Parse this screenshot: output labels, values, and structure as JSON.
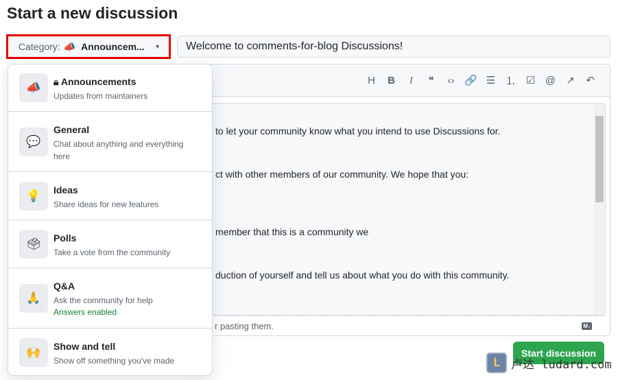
{
  "page_title": "Start a new discussion",
  "category_selector": {
    "label": "Category:",
    "icon": "megaphone-icon",
    "value": "Announcem...",
    "highlight_color": "#e00000"
  },
  "title_input": {
    "value": "Welcome to comments-for-blog Discussions!"
  },
  "toolbar": [
    "heading",
    "bold",
    "italic",
    "quote",
    "code",
    "link",
    "unordered-list",
    "ordered-list",
    "task-list",
    "mention",
    "reference",
    "undo"
  ],
  "toolbar_glyphs": [
    "H",
    "B",
    "I",
    "❝",
    "‹›",
    "🔗",
    "☰",
    "⒈",
    "☑",
    "@",
    "↗",
    "↶"
  ],
  "body_lines": [
    "to let your community know what you intend to use Discussions for.",
    "ct with other members of our community. We hope that you:",
    "member that this is a community we",
    "duction of yourself and tell us about what you do with this community."
  ],
  "footer_text": "r pasting them.",
  "markdown_badge": "M↓",
  "submit_label": "Start discussion",
  "submit_color": "#2da44e",
  "categories": [
    {
      "name": "Announcements",
      "description": "Updates from maintainers",
      "icon": "megaphone-icon",
      "emoji": "📣",
      "locked": true
    },
    {
      "name": "General",
      "description": "Chat about anything and everything here",
      "icon": "speech-balloon-icon",
      "emoji": "💬"
    },
    {
      "name": "Ideas",
      "description": "Share ideas for new features",
      "icon": "light-bulb-icon",
      "emoji": "💡"
    },
    {
      "name": "Polls",
      "description": "Take a vote from the community",
      "icon": "ballot-box-icon",
      "emoji": "🗳"
    },
    {
      "name": "Q&A",
      "description": "Ask the community for help",
      "note": "Answers enabled",
      "icon": "folded-hands-icon",
      "emoji": "🙏"
    },
    {
      "name": "Show and tell",
      "description": "Show off something you've made",
      "icon": "raised-hands-icon",
      "emoji": "🙌"
    }
  ],
  "watermark": "卢达 ludard.com"
}
